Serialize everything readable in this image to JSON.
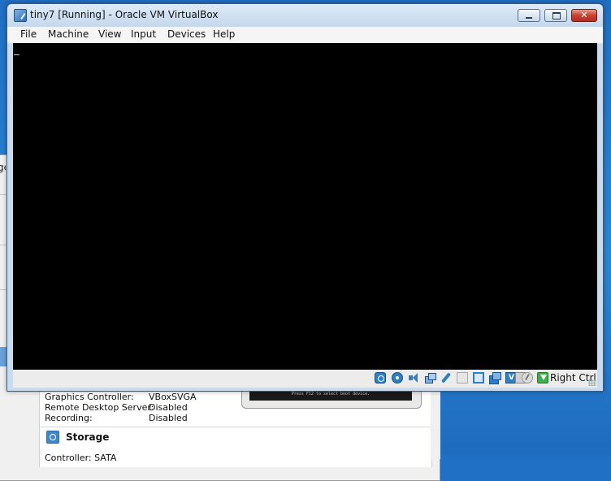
{
  "window": {
    "title": "tiny7 [Running] - Oracle VM VirtualBox",
    "icon": "virtualbox-icon"
  },
  "menu": {
    "items": [
      {
        "label": "File"
      },
      {
        "label": "Machine"
      },
      {
        "label": "View"
      },
      {
        "label": "Input"
      },
      {
        "label": "Devices"
      },
      {
        "label": "Help"
      }
    ]
  },
  "statusbar": {
    "host_key": "Right Ctrl",
    "icons": [
      "hard-disk-icon",
      "optical-drive-icon",
      "audio-icon",
      "network-icon",
      "usb-icon",
      "shared-folders-icon",
      "display-icon",
      "video-capture-icon",
      "recording-icon",
      "virtualization-icon",
      "mouse-integration-icon",
      "keyboard-capture-icon"
    ]
  },
  "background_window": {
    "label_fragment": "ge",
    "details": [
      {
        "key": "Graphics Controller:",
        "value": "VBoxSVGA"
      },
      {
        "key": "Remote Desktop Server:",
        "value": "Disabled"
      },
      {
        "key": "Recording:",
        "value": "Disabled"
      }
    ],
    "storage_title": "Storage",
    "controller_text": "Controller: SATA",
    "preview_text": "Press F12 to select boot device."
  }
}
